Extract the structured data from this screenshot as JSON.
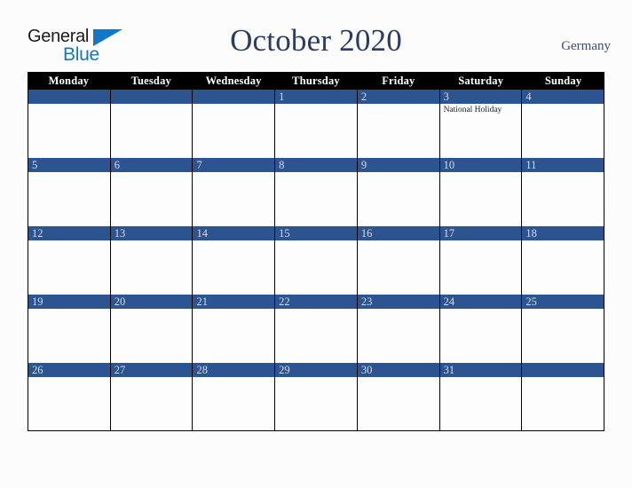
{
  "brand": {
    "name_part1": "General",
    "name_part2": "Blue",
    "triangle_icon": "triangle-icon",
    "primary_color": "#1277c4"
  },
  "header": {
    "title": "October 2020",
    "country": "Germany",
    "title_color": "#2b3c63"
  },
  "calendar": {
    "month": "October",
    "year": "2020",
    "weekday_headers": [
      "Monday",
      "Tuesday",
      "Wednesday",
      "Thursday",
      "Friday",
      "Saturday",
      "Sunday"
    ],
    "header_bg": "#000000",
    "day_bar_color": "#2c5490",
    "day_number_color": "#d8dce4",
    "weeks": [
      [
        {
          "day": "",
          "events": []
        },
        {
          "day": "",
          "events": []
        },
        {
          "day": "",
          "events": []
        },
        {
          "day": "1",
          "events": []
        },
        {
          "day": "2",
          "events": []
        },
        {
          "day": "3",
          "events": [
            "National Holiday"
          ]
        },
        {
          "day": "4",
          "events": []
        }
      ],
      [
        {
          "day": "5",
          "events": []
        },
        {
          "day": "6",
          "events": []
        },
        {
          "day": "7",
          "events": []
        },
        {
          "day": "8",
          "events": []
        },
        {
          "day": "9",
          "events": []
        },
        {
          "day": "10",
          "events": []
        },
        {
          "day": "11",
          "events": []
        }
      ],
      [
        {
          "day": "12",
          "events": []
        },
        {
          "day": "13",
          "events": []
        },
        {
          "day": "14",
          "events": []
        },
        {
          "day": "15",
          "events": []
        },
        {
          "day": "16",
          "events": []
        },
        {
          "day": "17",
          "events": []
        },
        {
          "day": "18",
          "events": []
        }
      ],
      [
        {
          "day": "19",
          "events": []
        },
        {
          "day": "20",
          "events": []
        },
        {
          "day": "21",
          "events": []
        },
        {
          "day": "22",
          "events": []
        },
        {
          "day": "23",
          "events": []
        },
        {
          "day": "24",
          "events": []
        },
        {
          "day": "25",
          "events": []
        }
      ],
      [
        {
          "day": "26",
          "events": []
        },
        {
          "day": "27",
          "events": []
        },
        {
          "day": "28",
          "events": []
        },
        {
          "day": "29",
          "events": []
        },
        {
          "day": "30",
          "events": []
        },
        {
          "day": "31",
          "events": []
        },
        {
          "day": "",
          "events": []
        }
      ]
    ]
  }
}
